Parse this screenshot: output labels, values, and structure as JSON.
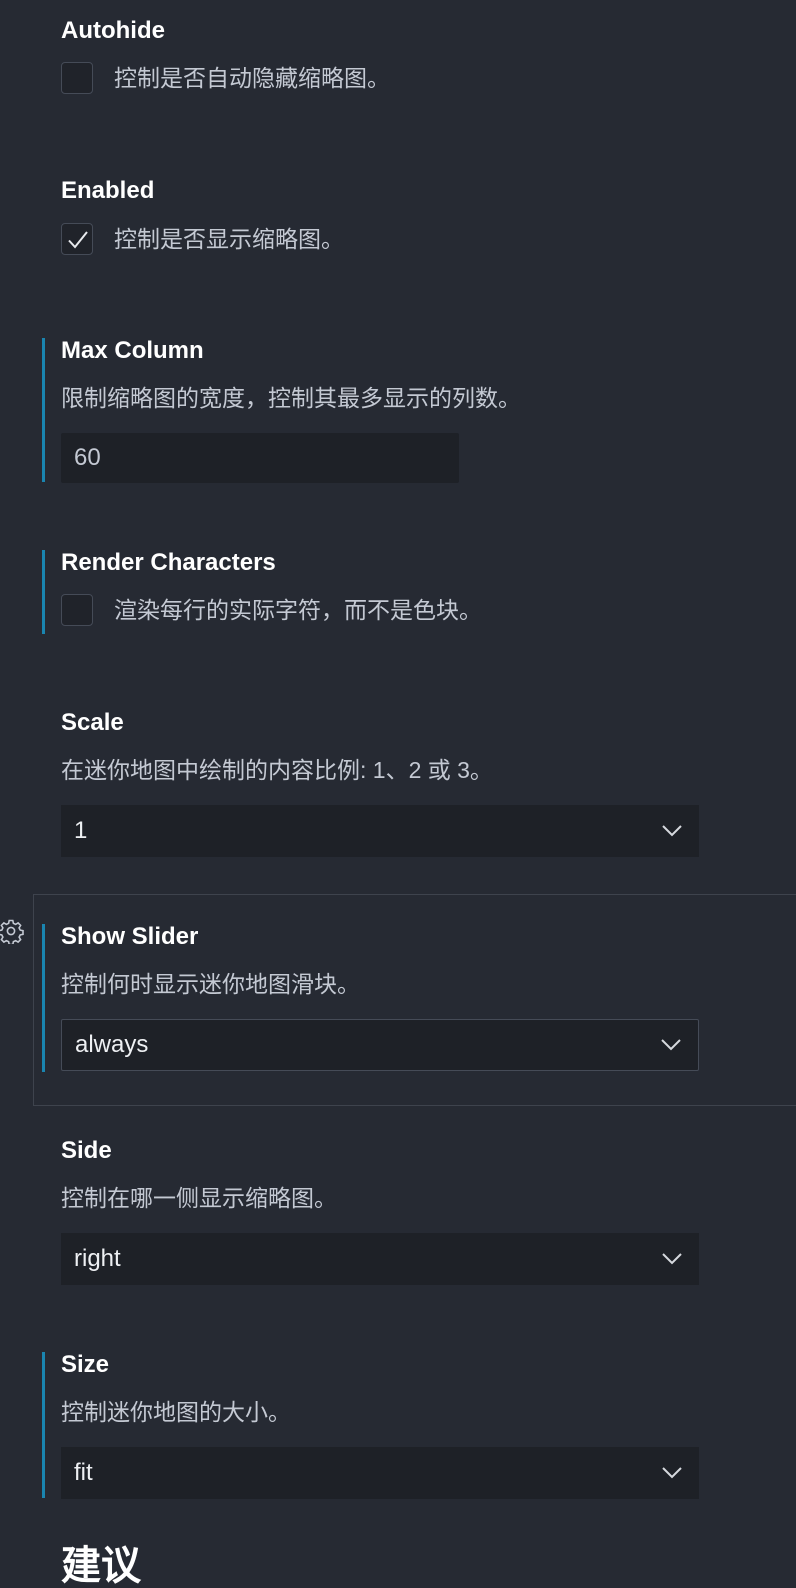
{
  "settings": {
    "autohide": {
      "title": "Autohide",
      "description": "控制是否自动隐藏缩略图。",
      "checked": false
    },
    "enabled": {
      "title": "Enabled",
      "description": "控制是否显示缩略图。",
      "checked": true
    },
    "max_column": {
      "title": "Max Column",
      "description": "限制缩略图的宽度，控制其最多显示的列数。",
      "value": "60"
    },
    "render_characters": {
      "title": "Render Characters",
      "description": "渲染每行的实际字符，而不是色块。",
      "checked": false
    },
    "scale": {
      "title": "Scale",
      "description": "在迷你地图中绘制的内容比例: 1、2 或 3。",
      "value": "1"
    },
    "show_slider": {
      "title": "Show Slider",
      "description": "控制何时显示迷你地图滑块。",
      "value": "always"
    },
    "side": {
      "title": "Side",
      "description": "控制在哪一侧显示缩略图。",
      "value": "right"
    },
    "size": {
      "title": "Size",
      "description": "控制迷你地图的大小。",
      "value": "fit"
    }
  },
  "next_section": {
    "title": "建议"
  },
  "colors": {
    "background": "#262a33",
    "modified_indicator": "#1a85b0",
    "input_background": "#1e2127",
    "title_text": "#ffffff",
    "description_text": "#c4c9d3"
  },
  "icons": {
    "gear": "gear-icon",
    "chevron": "chevron-down-icon",
    "check": "checkmark-icon"
  }
}
